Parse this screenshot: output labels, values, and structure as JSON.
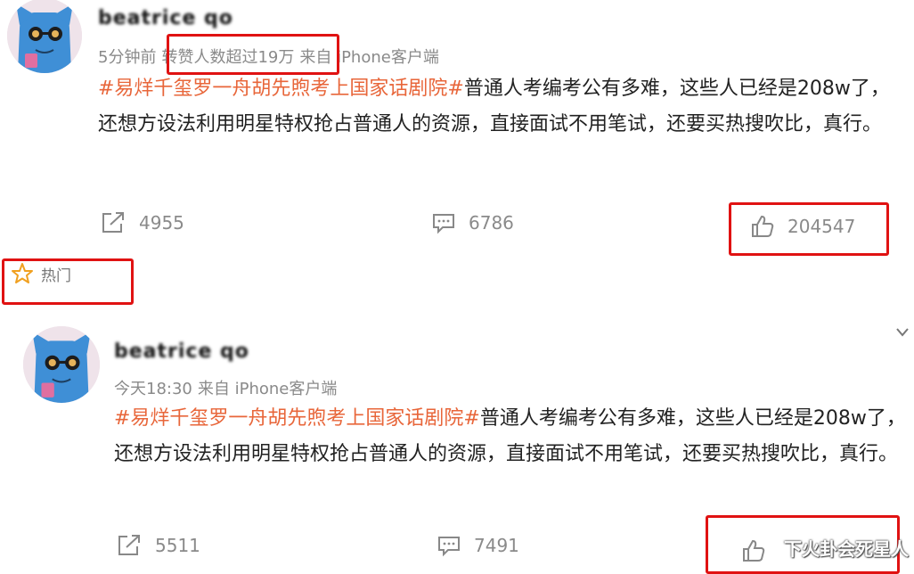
{
  "posts": [
    {
      "username": "beatrice qo",
      "time": "5分钟前",
      "repost_note": "转赞人数超过19万",
      "source": "来自 iPhone客户端",
      "hashtag": "#易烊千玺罗一舟胡先煦考上国家话剧院#",
      "text": "普通人考编考公有多难，这些人已经是208w了，还想方设法利用明星特权抢占普通人的资源，直接面试不用笔试，还要买热搜吹比，真行。",
      "reposts": "4955",
      "comments": "6786",
      "likes": "204547"
    },
    {
      "username": "beatrice qo",
      "time": "今天18:30",
      "source": "来自 iPhone客户端",
      "hashtag": "#易烊千玺罗一舟胡先煦考上国家话剧院#",
      "text": "普通人考编考公有多难，这些人已经是208w了，还想方设法利用明星特权抢占普通人的资源，直接面试不用笔试，还要买热搜吹比，真行。",
      "reposts": "5511",
      "comments": "7491"
    }
  ],
  "hot_label": "热门",
  "watermark": "下火卦会死星人",
  "icons": {
    "repost": "share-arrow-icon",
    "comment": "comment-bubble-icon",
    "like": "thumbs-up-icon",
    "hot": "star-icon"
  },
  "colors": {
    "hashtag": "#e8663a",
    "highlight_box": "#e01212",
    "hot_star": "#f0a020"
  }
}
